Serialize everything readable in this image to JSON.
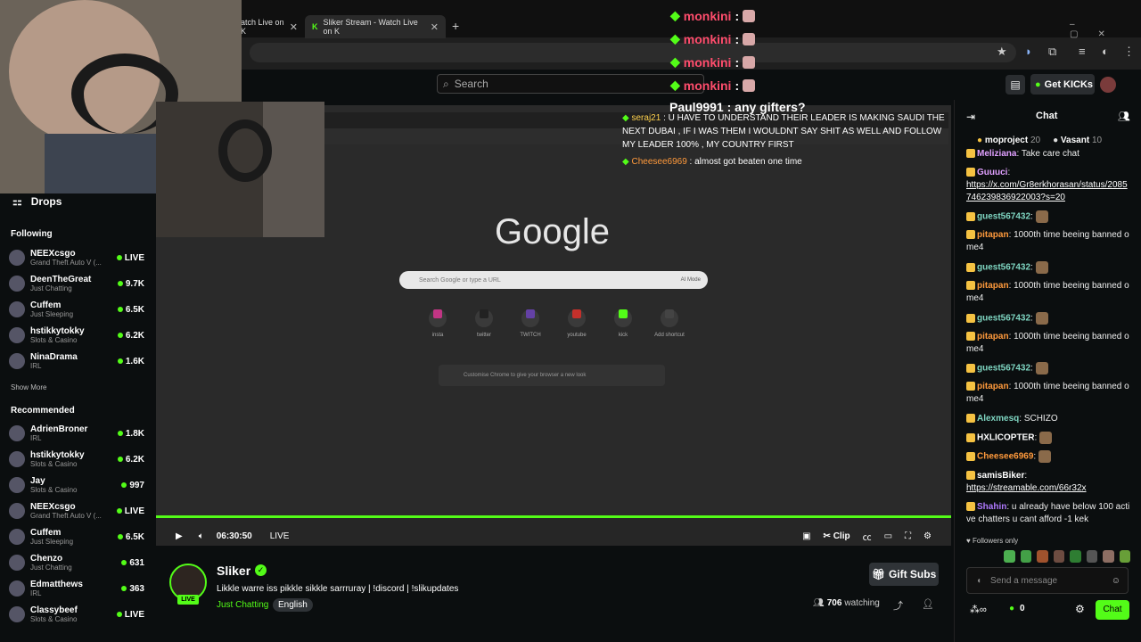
{
  "browser": {
    "tabs": [
      {
        "title": "atch Live on K",
        "active": false
      },
      {
        "title": "Sliker Stream - Watch Live on K",
        "active": true
      }
    ],
    "new_tab": "+"
  },
  "header": {
    "search_placeholder": "Search",
    "get_kicks": "Get KICKs"
  },
  "sidebar": {
    "drops": "Drops",
    "following_title": "Following",
    "following": [
      {
        "name": "NEEXcsgo",
        "category": "Grand Theft Auto V (...",
        "count": "LIVE"
      },
      {
        "name": "DeenTheGreat",
        "category": "Just Chatting",
        "count": "9.7K"
      },
      {
        "name": "Cuffem",
        "category": "Just Sleeping",
        "count": "6.5K"
      },
      {
        "name": "hstikkytokky",
        "category": "Slots & Casino",
        "count": "6.2K"
      },
      {
        "name": "NinaDrama",
        "category": "IRL",
        "count": "1.6K"
      }
    ],
    "show_more": "Show More",
    "recommended_title": "Recommended",
    "recommended": [
      {
        "name": "AdrienBroner",
        "category": "IRL",
        "count": "1.8K"
      },
      {
        "name": "hstikkytokky",
        "category": "Slots & Casino",
        "count": "6.2K"
      },
      {
        "name": "Jay",
        "category": "Slots & Casino",
        "count": "997"
      },
      {
        "name": "NEEXcsgo",
        "category": "Grand Theft Auto V (...",
        "count": "LIVE"
      },
      {
        "name": "Cuffem",
        "category": "Just Sleeping",
        "count": "6.5K"
      },
      {
        "name": "Chenzo",
        "category": "Just Chatting",
        "count": "631"
      },
      {
        "name": "Edmatthews",
        "category": "IRL",
        "count": "363"
      },
      {
        "name": "Classybeef",
        "category": "Slots & Casino",
        "count": "LIVE"
      }
    ]
  },
  "overlay": {
    "monkini": [
      "monkini",
      "monkini",
      "monkini",
      "monkini"
    ],
    "paul": "Paul9991 : any gifters?",
    "msg1_user": "seraj21",
    "msg1": "U HAVE TO UNDERSTAND THEIR LEADER IS MAKING SAUDI THE NEXT DUBAI , IF I WAS THEM I WOULDNT SAY SHIT AS WELL AND FOLLOW MY LEADER 100% , MY COUNTRY FIRST",
    "msg2_user": "Cheesee6969",
    "msg2": "almost got beaten one time"
  },
  "video": {
    "google": "Google",
    "google_search": "Search Google or type a URL",
    "ai_mode": "AI Mode",
    "shortcuts": [
      "insta",
      "twitter",
      "TWITCH",
      "youtube",
      "kick",
      "Add shortcut"
    ],
    "customize": "Customise Chrome to give your browser a new look",
    "time": "06:30:50",
    "live": "LIVE",
    "clip": "Clip"
  },
  "streamer": {
    "name": "Sliker",
    "title": "Likkle warre iss pikkle sikkle sarrruray | !discord | !slikupdates",
    "category": "Just Chatting",
    "language": "English",
    "live_badge": "LIVE",
    "gift_subs": "Gift Subs",
    "watching_count": "706",
    "watching_label": "watching"
  },
  "chat": {
    "title": "Chat",
    "top": [
      {
        "name": "moproject",
        "count": "20"
      },
      {
        "name": "Vasant",
        "count": "10"
      }
    ],
    "messages": [
      {
        "user": "Meliziana",
        "text": "Take care chat",
        "color": "#e0a0ff"
      },
      {
        "user": "Guuuci",
        "text": "https://x.com/Gr8erkhorasan/status/2085746239836922003?s=20",
        "color": "#e0a0ff",
        "link": true
      },
      {
        "user": "guest567432",
        "text": "",
        "color": "#7fd6c2"
      },
      {
        "user": "pitapan",
        "text": "1000th time beeing banned ome4",
        "color": "#ff9a3c"
      },
      {
        "user": "guest567432",
        "text": "",
        "color": "#7fd6c2"
      },
      {
        "user": "pitapan",
        "text": "1000th time beeing banned ome4",
        "color": "#ff9a3c"
      },
      {
        "user": "guest567432",
        "text": "",
        "color": "#7fd6c2"
      },
      {
        "user": "pitapan",
        "text": "1000th time beeing banned ome4",
        "color": "#ff9a3c"
      },
      {
        "user": "guest567432",
        "text": "",
        "color": "#7fd6c2"
      },
      {
        "user": "pitapan",
        "text": "1000th time beeing banned ome4",
        "color": "#ff9a3c"
      },
      {
        "user": "Alexmesq",
        "text": "SCHIZO",
        "color": "#7fd6c2"
      },
      {
        "user": "HXLICOPTER",
        "text": "",
        "color": "#fff"
      },
      {
        "user": "Cheesee6969",
        "text": "",
        "color": "#ff9a3c"
      },
      {
        "user": "samisBiker",
        "text": "https://streamable.com/66r32x",
        "color": "#fff",
        "link": true
      },
      {
        "user": "Shahin",
        "text": "u already have below 100 active chatters u cant afford -1 kek",
        "color": "#b07aff"
      }
    ],
    "followers_only": "Followers only",
    "send_placeholder": "Send a message",
    "kicks": "0",
    "chat_button": "Chat"
  },
  "colors": {
    "accent": "#53fc18"
  }
}
